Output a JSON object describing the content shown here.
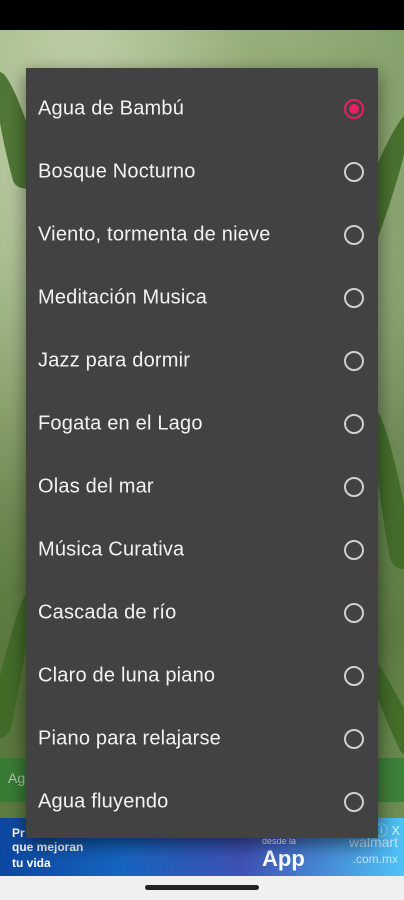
{
  "background_app": {
    "bottom_bar_text": "Ag"
  },
  "ad": {
    "line1": "Pr",
    "line2": "que mejoran",
    "line3": "tu vida",
    "desde": "desde la",
    "app": "App",
    "brand1": "walmart",
    "brand2": ".com.mx",
    "close": "ⓘ X"
  },
  "dialog": {
    "selected_index": 0,
    "accent_color": "#e91e63",
    "options": [
      {
        "label": "Agua de Bambú",
        "checked": true
      },
      {
        "label": "Bosque Nocturno",
        "checked": false
      },
      {
        "label": "Viento, tormenta de nieve",
        "checked": false
      },
      {
        "label": "Meditación Musica",
        "checked": false
      },
      {
        "label": "Jazz para dormir",
        "checked": false
      },
      {
        "label": "Fogata en el Lago",
        "checked": false
      },
      {
        "label": "Olas del mar",
        "checked": false
      },
      {
        "label": "Música Curativa",
        "checked": false
      },
      {
        "label": "Cascada de río",
        "checked": false
      },
      {
        "label": "Claro de luna piano",
        "checked": false
      },
      {
        "label": "Piano para relajarse",
        "checked": false
      },
      {
        "label": "Agua fluyendo",
        "checked": false
      }
    ]
  }
}
